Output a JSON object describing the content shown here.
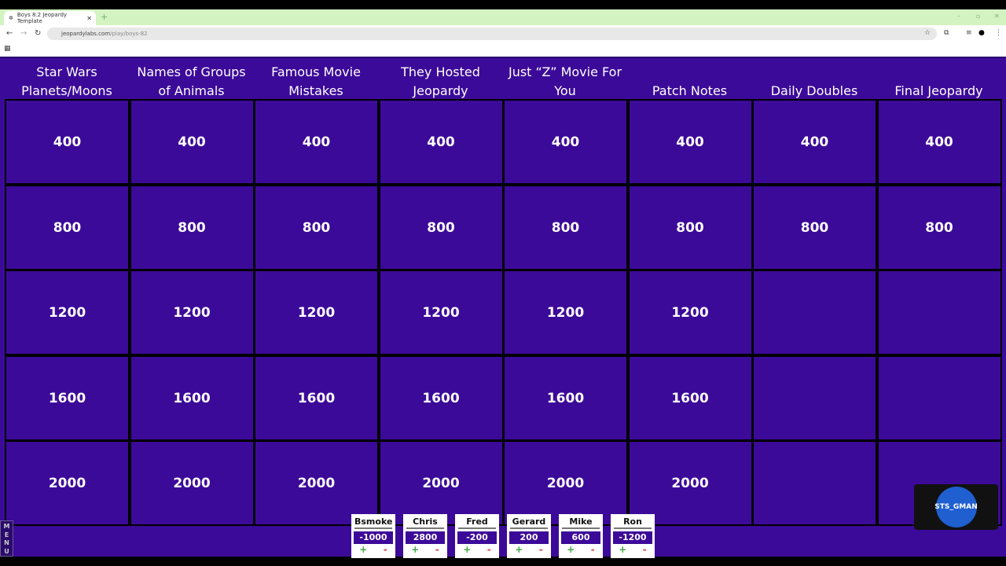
{
  "browser": {
    "tab_title": "Boys 8.2 Jeopardy Template",
    "url_domain": "jeopardylabs.com",
    "url_path": "/play/boys-82"
  },
  "board": {
    "categories": [
      "Star Wars Planets/Moons",
      "Names of Groups of Animals",
      "Famous Movie Mistakes",
      "They Hosted Jeopardy",
      "Just “Z” Movie For You",
      "Patch Notes",
      "Daily Doubles",
      "Final Jeopardy"
    ],
    "rows": [
      [
        "400",
        "400",
        "400",
        "400",
        "400",
        "400",
        "400",
        "400"
      ],
      [
        "800",
        "800",
        "800",
        "800",
        "800",
        "800",
        "800",
        "800"
      ],
      [
        "1200",
        "1200",
        "1200",
        "1200",
        "1200",
        "1200",
        "",
        ""
      ],
      [
        "1600",
        "1600",
        "1600",
        "1600",
        "1600",
        "1600",
        "",
        ""
      ],
      [
        "2000",
        "2000",
        "2000",
        "2000",
        "2000",
        "2000",
        "",
        ""
      ]
    ]
  },
  "menu_label": "MENU",
  "teams": [
    {
      "name": "Bsmoke",
      "score": "-1000"
    },
    {
      "name": "Chris",
      "score": "2800"
    },
    {
      "name": "Fred",
      "score": "-200"
    },
    {
      "name": "Gerard",
      "score": "200"
    },
    {
      "name": "Mike",
      "score": "600"
    },
    {
      "name": "Ron",
      "score": "-1200"
    }
  ],
  "controls": {
    "plus": "+",
    "minus": "-"
  },
  "watermark": "STS_GMAN"
}
